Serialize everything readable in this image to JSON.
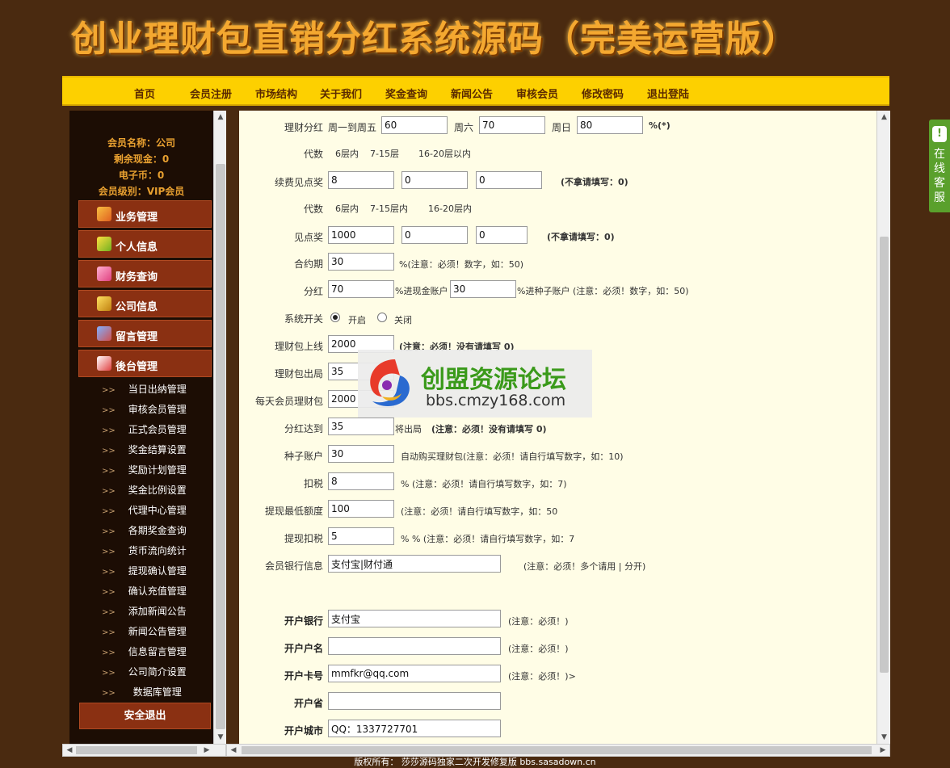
{
  "banner": {
    "title": "创业理财包直销分红系统源码（完美运营版）"
  },
  "nav": [
    "首页",
    "会员注册",
    "市场结构",
    "关于我们",
    "奖金查询",
    "新闻公告",
    "审核会员",
    "修改密码",
    "退出登陆"
  ],
  "member": {
    "name": "会员名称：公司",
    "cash": "剩余现金：0",
    "ecoin": "电子币：0",
    "level": "会员级别：VIP会员"
  },
  "menu": [
    "业务管理",
    "个人信息",
    "财务查询",
    "公司信息",
    "留言管理",
    "後台管理"
  ],
  "submenu_arrow": ">>",
  "submenu": [
    "当日出纳管理",
    "审核会员管理",
    "正式会员管理",
    "奖金结算设置",
    "奖励计划管理",
    "奖金比例设置",
    "代理中心管理",
    "各期奖金查询",
    "货币流向统计",
    "提现确认管理",
    "确认充值管理",
    "添加新闻公告",
    "新闻公告管理",
    "信息留言管理",
    "公司简介设置",
    "数据库管理"
  ],
  "logout": "安全退出",
  "form": {
    "fh": {
      "label": "理财分红",
      "t1": "周一到周五",
      "v1": "60",
      "t2": "周六",
      "v2": "70",
      "t3": "周日",
      "v3": "80",
      "suffix": "%(*)"
    },
    "dai1": {
      "label": "代数",
      "a": "6层内",
      "b": "7-15层",
      "c": "16-20层以内"
    },
    "xf": {
      "label": "续费见点奖",
      "v1": "8",
      "v2": "0",
      "v3": "0",
      "note": "(不拿请填写：0)"
    },
    "dai2": {
      "label": "代数",
      "a": "6层内",
      "b": "7-15层内",
      "c": "16-20层内"
    },
    "jd": {
      "label": "见点奖",
      "v1": "1000",
      "v2": "0",
      "v3": "0",
      "note": "(不拿请填写：0)"
    },
    "hy": {
      "label": "合约期",
      "v": "30",
      "note": "%(注意：必须！数字，如：50)"
    },
    "fenhong": {
      "label": "分红",
      "v1": "70",
      "t1": "%进现金账户",
      "v2": "30",
      "t2": "%进种子账户 (注意：必须！数字，如：50)"
    },
    "switch": {
      "label": "系统开关",
      "on": "开启",
      "off": "关闭"
    },
    "sx": {
      "label": "理财包上线",
      "v": "2000",
      "note": "(注意：必须！没有请填写 0)"
    },
    "cj": {
      "label": "理财包出局",
      "v": "35"
    },
    "mt": {
      "label": "每天会员理财包",
      "v": "2000"
    },
    "fd": {
      "label": "分红达到",
      "v": "35",
      "t": "将出局",
      "note": "(注意：必须！没有请填写 0)"
    },
    "zz": {
      "label": "种子账户",
      "v": "30",
      "note": "自动购买理财包(注意：必须！请自行填写数字，如：10)"
    },
    "ks": {
      "label": "扣税",
      "v": "8",
      "note": "% (注意：必须！请自行填写数字，如：7)"
    },
    "zd": {
      "label": "提现最低额度",
      "v": "100",
      "note": "(注意：必须！请自行填写数字，如：50"
    },
    "tk": {
      "label": "提现扣税",
      "v": "5",
      "note": "%  % (注意：必须！请自行填写数字，如：7"
    },
    "yh": {
      "label": "会员银行信息",
      "v": "支付宝|财付通",
      "note": "(注意：必须！多个请用 | 分开)"
    },
    "khyh": {
      "label": "开户银行",
      "v": "支付宝",
      "note": "(注意：必须！)"
    },
    "khhm": {
      "label": "开户户名",
      "v": "",
      "note": "(注意：必须！)"
    },
    "khkh": {
      "label": "开户卡号",
      "v": "mmfkr@qq.com",
      "note": "(注意：必须！)>"
    },
    "khs": {
      "label": "开户省",
      "v": ""
    },
    "khcs": {
      "label": "开户城市",
      "v": "QQ：1337727701"
    }
  },
  "watermark": {
    "title": "创盟资源论坛",
    "url": "bbs.cmzy168.com"
  },
  "online_service": "在线客服",
  "footer": "版权所有：  莎莎源码独家二次开发修复版 bbs.sasadown.cn",
  "icons": [
    "briefcase-icon",
    "stars-icon",
    "gift-icon",
    "coins-icon",
    "message-icon",
    "home-icon"
  ],
  "colors": {
    "nav_bg": "#fdd000",
    "menu_bg": "#8a3012",
    "page_bg": "#4a2a10",
    "form_bg": "#fffde6"
  }
}
